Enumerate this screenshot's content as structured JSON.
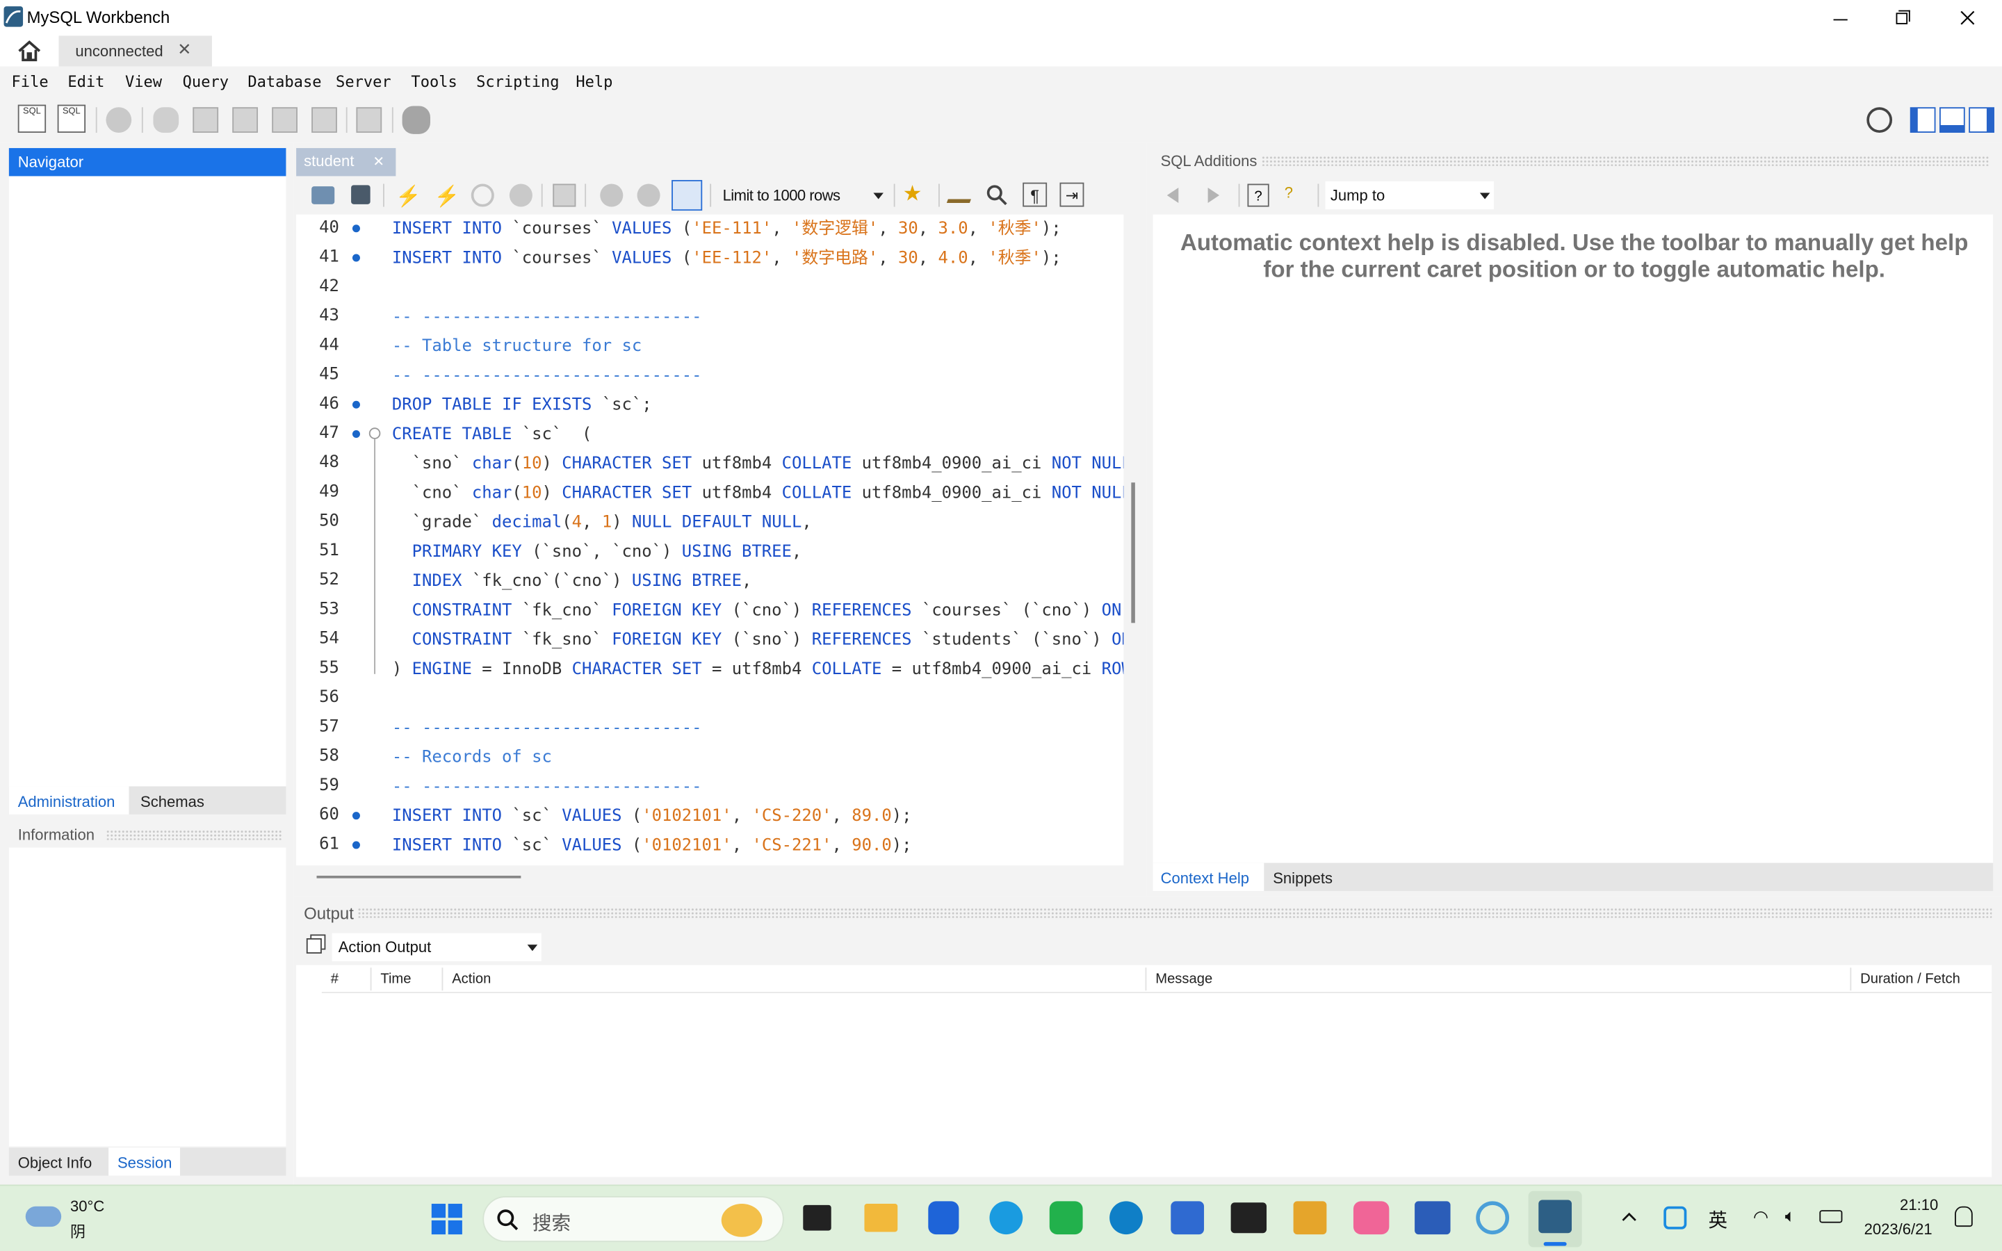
{
  "window": {
    "title": "MySQL Workbench"
  },
  "connection_tab": {
    "label": "unconnected"
  },
  "menu": [
    "File",
    "Edit",
    "View",
    "Query",
    "Database",
    "Server",
    "Tools",
    "Scripting",
    "Help"
  ],
  "navigator": {
    "title": "Navigator",
    "tabs": [
      "Administration",
      "Schemas"
    ]
  },
  "information": {
    "title": "Information",
    "tabs": [
      "Object Info",
      "Session"
    ]
  },
  "editor": {
    "tab_label": "student",
    "limit_select": "Limit to 1000 rows",
    "lines": [
      {
        "n": "40",
        "dot": true,
        "fold": false,
        "toks": [
          [
            "kw",
            "INSERT INTO "
          ],
          [
            "id",
            "`courses` "
          ],
          [
            "kw",
            "VALUES "
          ],
          [
            "id",
            "("
          ],
          [
            "str",
            "'EE-111'"
          ],
          [
            "id",
            ", "
          ],
          [
            "str",
            "'数字逻辑'"
          ],
          [
            "id",
            ", "
          ],
          [
            "num",
            "30"
          ],
          [
            "id",
            ", "
          ],
          [
            "num",
            "3.0"
          ],
          [
            "id",
            ", "
          ],
          [
            "str",
            "'秋季'"
          ],
          [
            "id",
            ");"
          ]
        ]
      },
      {
        "n": "41",
        "dot": true,
        "fold": false,
        "toks": [
          [
            "kw",
            "INSERT INTO "
          ],
          [
            "id",
            "`courses` "
          ],
          [
            "kw",
            "VALUES "
          ],
          [
            "id",
            "("
          ],
          [
            "str",
            "'EE-112'"
          ],
          [
            "id",
            ", "
          ],
          [
            "str",
            "'数字电路'"
          ],
          [
            "id",
            ", "
          ],
          [
            "num",
            "30"
          ],
          [
            "id",
            ", "
          ],
          [
            "num",
            "4.0"
          ],
          [
            "id",
            ", "
          ],
          [
            "str",
            "'秋季'"
          ],
          [
            "id",
            ");"
          ]
        ]
      },
      {
        "n": "42",
        "dot": false,
        "fold": false,
        "toks": []
      },
      {
        "n": "43",
        "dot": false,
        "fold": false,
        "toks": [
          [
            "cm",
            "-- ----------------------------"
          ]
        ]
      },
      {
        "n": "44",
        "dot": false,
        "fold": false,
        "toks": [
          [
            "cm",
            "-- Table structure for sc"
          ]
        ]
      },
      {
        "n": "45",
        "dot": false,
        "fold": false,
        "toks": [
          [
            "cm",
            "-- ----------------------------"
          ]
        ]
      },
      {
        "n": "46",
        "dot": true,
        "fold": false,
        "toks": [
          [
            "kw",
            "DROP TABLE IF EXISTS "
          ],
          [
            "id",
            "`sc`;"
          ]
        ]
      },
      {
        "n": "47",
        "dot": true,
        "fold": true,
        "toks": [
          [
            "kw",
            "CREATE TABLE "
          ],
          [
            "id",
            "`sc`  ("
          ]
        ]
      },
      {
        "n": "48",
        "dot": false,
        "fold": false,
        "toks": [
          [
            "id",
            "  `sno` "
          ],
          [
            "kw",
            "char"
          ],
          [
            "id",
            "("
          ],
          [
            "num",
            "10"
          ],
          [
            "id",
            ") "
          ],
          [
            "kw",
            "CHARACTER SET "
          ],
          [
            "id",
            "utf8mb4 "
          ],
          [
            "kw",
            "COLLATE "
          ],
          [
            "id",
            "utf8mb4_0900_ai_ci "
          ],
          [
            "kw",
            "NOT NULL"
          ],
          [
            "id",
            ","
          ]
        ]
      },
      {
        "n": "49",
        "dot": false,
        "fold": false,
        "toks": [
          [
            "id",
            "  `cno` "
          ],
          [
            "kw",
            "char"
          ],
          [
            "id",
            "("
          ],
          [
            "num",
            "10"
          ],
          [
            "id",
            ") "
          ],
          [
            "kw",
            "CHARACTER SET "
          ],
          [
            "id",
            "utf8mb4 "
          ],
          [
            "kw",
            "COLLATE "
          ],
          [
            "id",
            "utf8mb4_0900_ai_ci "
          ],
          [
            "kw",
            "NOT NULL"
          ],
          [
            "id",
            ","
          ]
        ]
      },
      {
        "n": "50",
        "dot": false,
        "fold": false,
        "toks": [
          [
            "id",
            "  `grade` "
          ],
          [
            "kw",
            "decimal"
          ],
          [
            "id",
            "("
          ],
          [
            "num",
            "4"
          ],
          [
            "id",
            ", "
          ],
          [
            "num",
            "1"
          ],
          [
            "id",
            ") "
          ],
          [
            "kw",
            "NULL DEFAULT NULL"
          ],
          [
            "id",
            ","
          ]
        ]
      },
      {
        "n": "51",
        "dot": false,
        "fold": false,
        "toks": [
          [
            "kw",
            "  PRIMARY KEY "
          ],
          [
            "id",
            "(`sno`, `cno`) "
          ],
          [
            "kw",
            "USING BTREE"
          ],
          [
            "id",
            ","
          ]
        ]
      },
      {
        "n": "52",
        "dot": false,
        "fold": false,
        "toks": [
          [
            "kw",
            "  INDEX "
          ],
          [
            "id",
            "`fk_cno`(`cno`) "
          ],
          [
            "kw",
            "USING BTREE"
          ],
          [
            "id",
            ","
          ]
        ]
      },
      {
        "n": "53",
        "dot": false,
        "fold": false,
        "toks": [
          [
            "kw",
            "  CONSTRAINT "
          ],
          [
            "id",
            "`fk_cno` "
          ],
          [
            "kw",
            "FOREIGN KEY "
          ],
          [
            "id",
            "(`cno`) "
          ],
          [
            "kw",
            "REFERENCES "
          ],
          [
            "id",
            "`courses` (`cno`) "
          ],
          [
            "kw",
            "ON D"
          ]
        ]
      },
      {
        "n": "54",
        "dot": false,
        "fold": false,
        "toks": [
          [
            "kw",
            "  CONSTRAINT "
          ],
          [
            "id",
            "`fk_sno` "
          ],
          [
            "kw",
            "FOREIGN KEY "
          ],
          [
            "id",
            "(`sno`) "
          ],
          [
            "kw",
            "REFERENCES "
          ],
          [
            "id",
            "`students` (`sno`) "
          ],
          [
            "kw",
            "ON"
          ]
        ]
      },
      {
        "n": "55",
        "dot": false,
        "fold": false,
        "toks": [
          [
            "id",
            ") "
          ],
          [
            "kw",
            "ENGINE "
          ],
          [
            "id",
            "= InnoDB "
          ],
          [
            "kw",
            "CHARACTER SET "
          ],
          [
            "id",
            "= utf8mb4 "
          ],
          [
            "kw",
            "COLLATE "
          ],
          [
            "id",
            "= utf8mb4_0900_ai_ci "
          ],
          [
            "kw",
            "ROW_"
          ]
        ]
      },
      {
        "n": "56",
        "dot": false,
        "fold": false,
        "toks": []
      },
      {
        "n": "57",
        "dot": false,
        "fold": false,
        "toks": [
          [
            "cm",
            "-- ----------------------------"
          ]
        ]
      },
      {
        "n": "58",
        "dot": false,
        "fold": false,
        "toks": [
          [
            "cm",
            "-- Records of sc"
          ]
        ]
      },
      {
        "n": "59",
        "dot": false,
        "fold": false,
        "toks": [
          [
            "cm",
            "-- ----------------------------"
          ]
        ]
      },
      {
        "n": "60",
        "dot": true,
        "fold": false,
        "toks": [
          [
            "kw",
            "INSERT INTO "
          ],
          [
            "id",
            "`sc` "
          ],
          [
            "kw",
            "VALUES "
          ],
          [
            "id",
            "("
          ],
          [
            "str",
            "'0102101'"
          ],
          [
            "id",
            ", "
          ],
          [
            "str",
            "'CS-220'"
          ],
          [
            "id",
            ", "
          ],
          [
            "num",
            "89.0"
          ],
          [
            "id",
            ");"
          ]
        ]
      },
      {
        "n": "61",
        "dot": true,
        "fold": false,
        "toks": [
          [
            "kw",
            "INSERT INTO "
          ],
          [
            "id",
            "`sc` "
          ],
          [
            "kw",
            "VALUES "
          ],
          [
            "id",
            "("
          ],
          [
            "str",
            "'0102101'"
          ],
          [
            "id",
            ", "
          ],
          [
            "str",
            "'CS-221'"
          ],
          [
            "id",
            ", "
          ],
          [
            "num",
            "90.0"
          ],
          [
            "id",
            ");"
          ]
        ]
      }
    ]
  },
  "sql_additions": {
    "title": "SQL Additions",
    "jump_to": "Jump to",
    "help_text": "Automatic context help is disabled. Use the toolbar to manually get help for the current caret position or to toggle automatic help.",
    "tabs": [
      "Context Help",
      "Snippets"
    ]
  },
  "output": {
    "title": "Output",
    "select": "Action Output",
    "columns": [
      "#",
      "Time",
      "Action",
      "Message",
      "Duration / Fetch"
    ]
  },
  "taskbar": {
    "weather_temp": "30°C",
    "weather_desc": "阴",
    "search_placeholder": "搜索",
    "ime": "英",
    "time": "21:10",
    "date": "2023/6/21"
  },
  "colors": {
    "accent": "#0a64d8",
    "navigator_header": "#1a73e8",
    "taskbar_bg": "#dff0dc"
  }
}
